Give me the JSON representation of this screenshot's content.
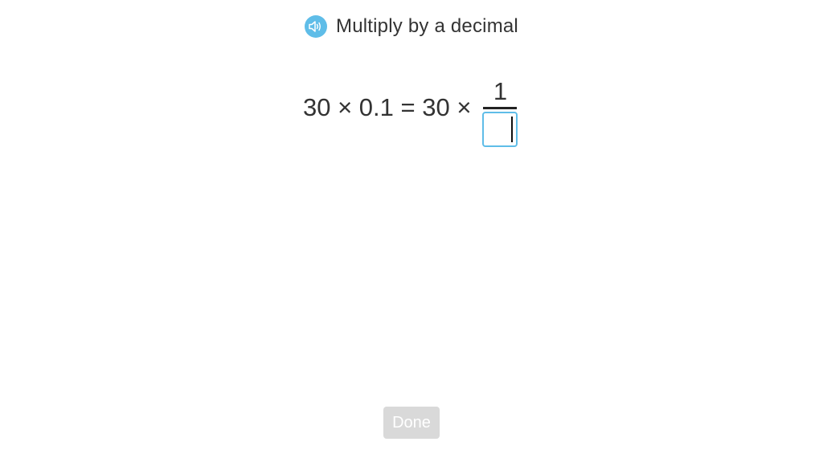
{
  "header": {
    "speaker_icon": "speaker-icon",
    "title": "Multiply by a decimal"
  },
  "equation": {
    "expression": "30 × 0.1 = 30 ×",
    "numerator": "1",
    "denominator_value": "",
    "denominator_placeholder": ""
  },
  "footer": {
    "done_label": "Done"
  },
  "colors": {
    "accent": "#5fbde8",
    "text": "#333333",
    "button_disabled": "#d9d9d9"
  }
}
